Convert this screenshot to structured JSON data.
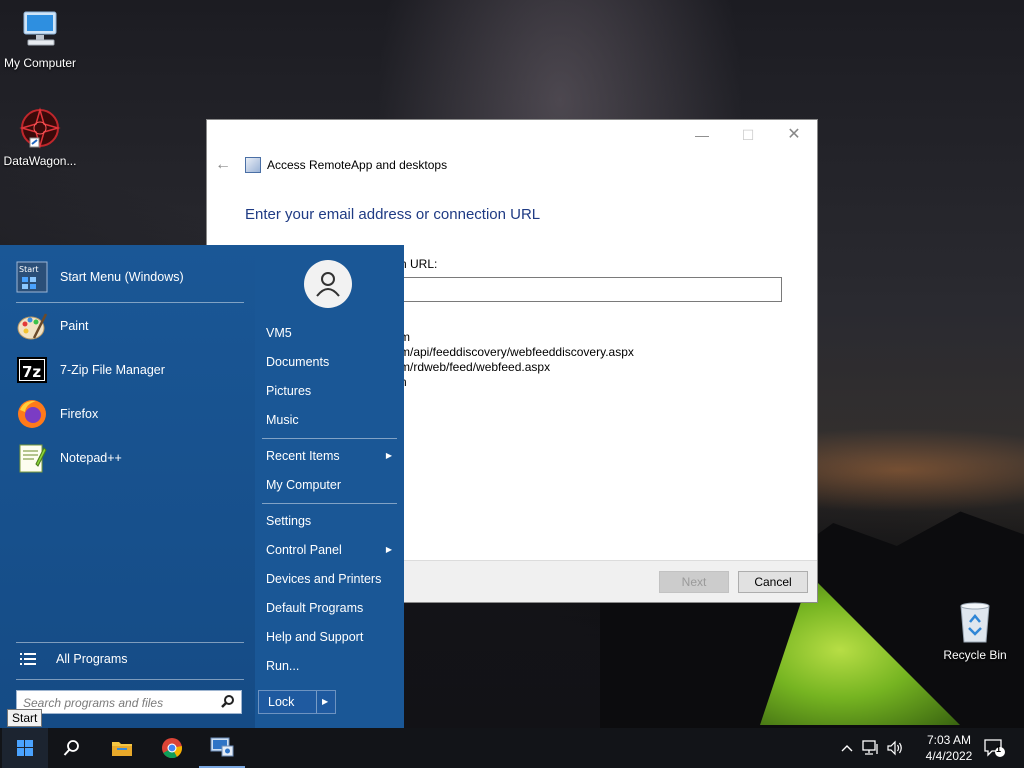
{
  "desktop": {
    "icons": [
      {
        "label": "My Computer",
        "icon": "monitor-icon"
      },
      {
        "label": "DataWagon...",
        "icon": "datawagon-icon"
      },
      {
        "label": "Recycle Bin",
        "icon": "recycle-bin-icon"
      }
    ]
  },
  "dialog": {
    "title": "Access RemoteApp and desktops",
    "heading": "Enter your email address or connection URL",
    "field_label": "n URL:",
    "field_value": "",
    "examples": [
      "m",
      "m/api/feeddiscovery/webfeeddiscovery.aspx",
      "m/rdweb/feed/webfeed.aspx",
      "n"
    ],
    "next_label": "Next",
    "cancel_label": "Cancel"
  },
  "start_menu": {
    "pinned": [
      {
        "label": "Start Menu (Windows)",
        "icon": "start-menu-icon"
      },
      {
        "label": "Paint",
        "icon": "paint-icon"
      },
      {
        "label": "7-Zip File Manager",
        "icon": "seven-zip-icon"
      },
      {
        "label": "Firefox",
        "icon": "firefox-icon"
      },
      {
        "label": "Notepad++",
        "icon": "notepadpp-icon"
      }
    ],
    "all_programs": "All Programs",
    "search_placeholder": "Search programs and files",
    "user": "VM5",
    "right_items": [
      {
        "label": "Documents"
      },
      {
        "label": "Pictures"
      },
      {
        "label": "Music"
      },
      {
        "label": "Recent Items",
        "submenu": true
      },
      {
        "label": "My Computer"
      },
      {
        "label": "Settings"
      },
      {
        "label": "Control Panel",
        "submenu": true
      },
      {
        "label": "Devices and Printers"
      },
      {
        "label": "Default Programs"
      },
      {
        "label": "Help and Support"
      },
      {
        "label": "Run..."
      }
    ],
    "lock_label": "Lock"
  },
  "tooltip": "Start",
  "taskbar": {
    "time": "7:03 AM",
    "date": "4/4/2022",
    "notification_count": "1"
  }
}
